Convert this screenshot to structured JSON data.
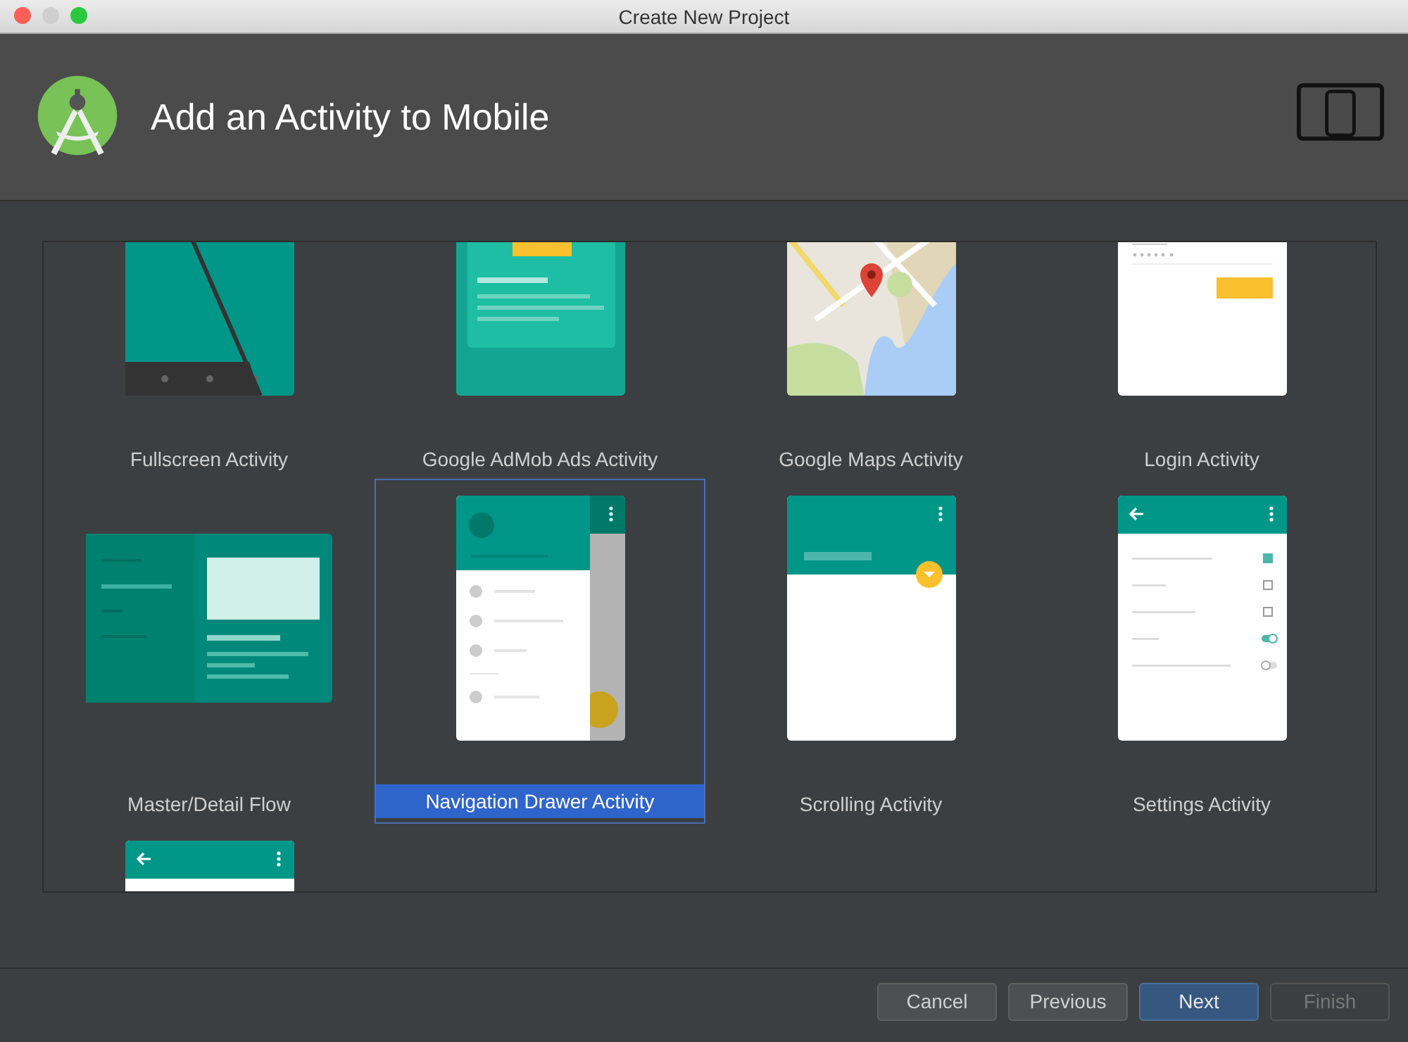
{
  "window": {
    "title": "Create New Project"
  },
  "header": {
    "title": "Add an Activity to Mobile"
  },
  "templates": [
    {
      "kind": "fullscreen",
      "label": "Fullscreen Activity",
      "selected": false
    },
    {
      "kind": "admob",
      "label": "Google AdMob Ads Activity",
      "selected": false
    },
    {
      "kind": "maps",
      "label": "Google Maps Activity",
      "selected": false
    },
    {
      "kind": "login",
      "label": "Login Activity",
      "selected": false
    },
    {
      "kind": "master-detail",
      "label": "Master/Detail Flow",
      "selected": false
    },
    {
      "kind": "navigation-drawer",
      "label": "Navigation Drawer Activity",
      "selected": true
    },
    {
      "kind": "scrolling",
      "label": "Scrolling Activity",
      "selected": false
    },
    {
      "kind": "settings",
      "label": "Settings Activity",
      "selected": false
    },
    {
      "kind": "basic",
      "selected": false
    }
  ],
  "buttons": [
    {
      "label": "Cancel",
      "default": false,
      "disabled": false
    },
    {
      "label": "Previous",
      "default": false,
      "disabled": false
    },
    {
      "label": "Next",
      "default": true,
      "disabled": false
    },
    {
      "label": "Finish",
      "default": false,
      "disabled": true
    }
  ]
}
